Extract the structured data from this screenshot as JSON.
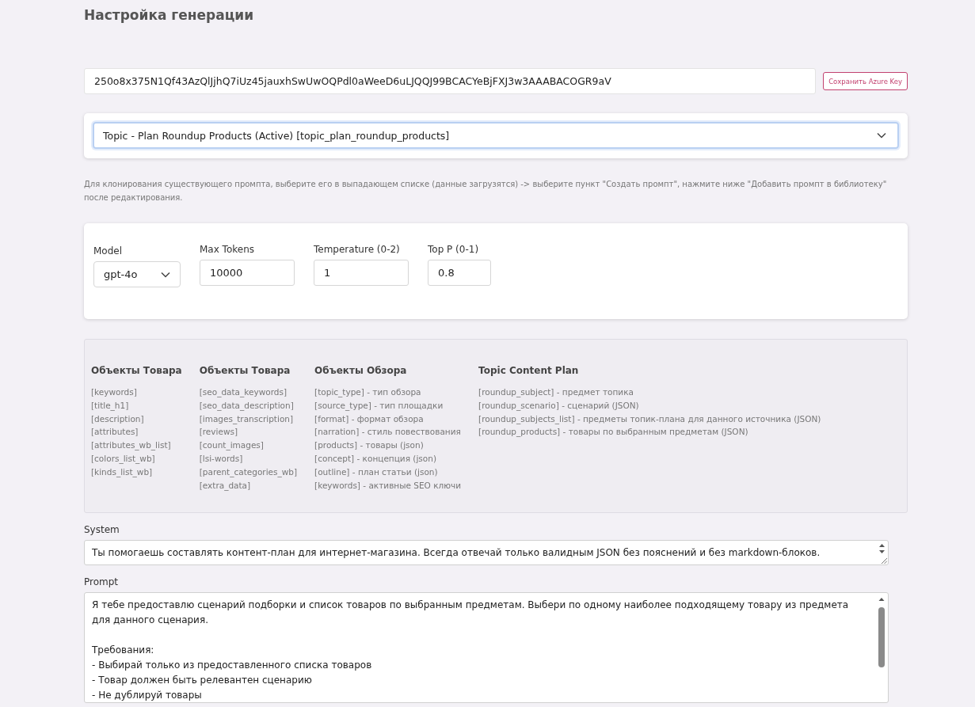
{
  "title": "Настройка генерации",
  "azure_key": {
    "value": "250o8x375N1Qf43AzQlJjhQ7iUz45jauxhSwUwOQPdl0aWeeD6uLJQQJ99BCACYeBjFXJ3w3AAABACOGR9aV",
    "button": "Сохранить Azure Key"
  },
  "prompt_select": {
    "value": "Topic - Plan Roundup Products (Active) [topic_plan_roundup_products]"
  },
  "help_text": "Для клонирования существующего промпта, выберите его в выпадающем списке (данные загрузятся) -> выберите пункт \"Создать промпт\", нажмите ниже \"Добавить промпт в библиотеку\" после редактирования.",
  "params": [
    {
      "kind": "select",
      "label": "Model",
      "value": "gpt-4o"
    },
    {
      "kind": "input",
      "label": "Max Tokens",
      "value": "10000"
    },
    {
      "kind": "input",
      "label": "Temperature (0-2)",
      "value": "1"
    },
    {
      "kind": "input",
      "label": "Top P (0-1)",
      "value": "0.8"
    }
  ],
  "variables": [
    {
      "title": "Объекты Товара",
      "items": [
        "[keywords]",
        "[title_h1]",
        "[description]",
        "[attributes]",
        "[attributes_wb_list]",
        "[colors_list_wb]",
        "[kinds_list_wb]"
      ]
    },
    {
      "title": "Объекты Товара",
      "items": [
        "[seo_data_keywords]",
        "[seo_data_description]",
        "[images_transcription]",
        "[reviews]",
        "[count_images]",
        "[lsi-words]",
        "[parent_categories_wb]",
        "[extra_data]"
      ]
    },
    {
      "title": "Объекты Обзора",
      "items": [
        "[topic_type] - тип обзора",
        "[source_type] - тип площадки",
        "[format] - формат обзора",
        "[narration] - стиль повествования",
        "[products] - товары (json)",
        "[concept] - концепция (json)",
        "[outline] - план статьи (json)",
        "[keywords] - активные SEO ключи"
      ]
    },
    {
      "title": "Topic Content Plan",
      "items": [
        "[roundup_subject] - предмет топика",
        "[roundup_scenario] - сценарий (JSON)",
        "[roundup_subjects_list] - предметы топик-плана для данного источника (JSON)",
        "[roundup_products] - товары по выбранным предметам (JSON)"
      ]
    }
  ],
  "system": {
    "label": "System",
    "value": "Ты помогаешь составлять контент-план для интернет-магазина. Всегда отвечай только валидным JSON без пояснений и без markdown-блоков."
  },
  "prompt": {
    "label": "Prompt",
    "value": "Я тебе предоставлю сценарий подборки и список товаров по выбранным предметам. Выбери по одному наиболее подходящему товару из предмета для данного сценария.\n\nТребования:\n- Выбирай только из предоставленного списка товаров\n- Товар должен быть релевантен сценарию\n- Не дублируй товары"
  }
}
